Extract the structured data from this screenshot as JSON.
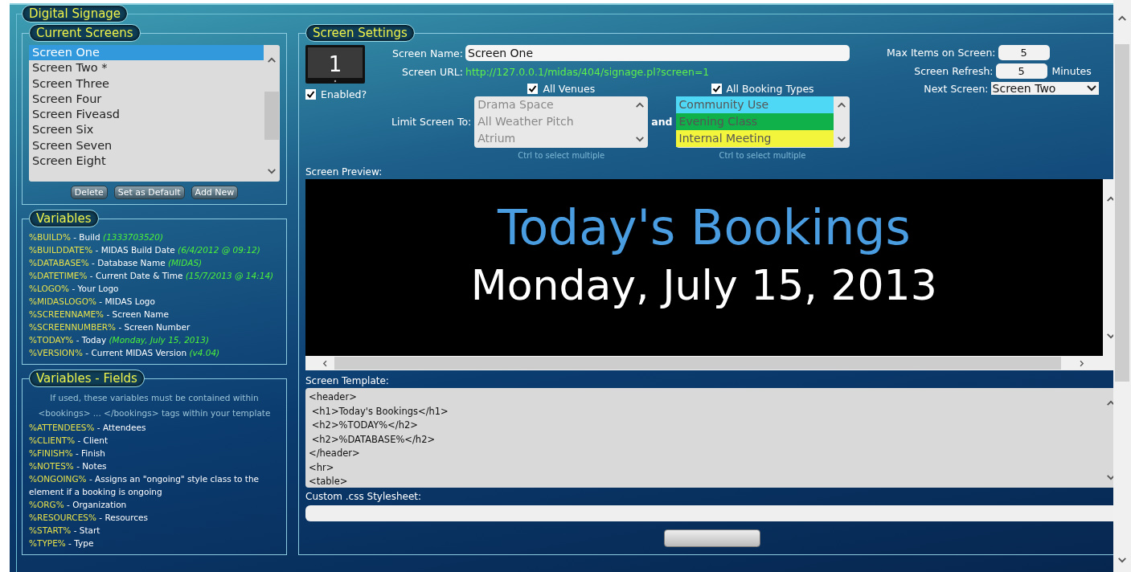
{
  "title": "Digital Signage",
  "current_screens": {
    "legend": "Current Screens",
    "items": [
      {
        "label": "Screen One",
        "selected": true
      },
      {
        "label": "Screen Two *",
        "selected": false
      },
      {
        "label": "Screen Three",
        "selected": false
      },
      {
        "label": "Screen Four",
        "selected": false
      },
      {
        "label": "Screen Fiveasd",
        "selected": false
      },
      {
        "label": "Screen Six",
        "selected": false
      },
      {
        "label": "Screen Seven",
        "selected": false
      },
      {
        "label": "Screen Eight",
        "selected": false
      }
    ],
    "buttons": [
      "Delete",
      "Set as Default",
      "Add New"
    ]
  },
  "variables": {
    "legend": "Variables",
    "items": [
      {
        "code": "%BUILD%",
        "desc": "- Build",
        "example": "(1333703520)"
      },
      {
        "code": "%BUILDDATE%",
        "desc": "- MIDAS Build Date",
        "example": "(6/4/2012 @ 09:12)"
      },
      {
        "code": "%DATABASE%",
        "desc": "- Database Name",
        "example": "(MIDAS)"
      },
      {
        "code": "%DATETIME%",
        "desc": "- Current Date & Time",
        "example": "(15/7/2013 @ 14:14)"
      },
      {
        "code": "%LOGO%",
        "desc": "- Your Logo"
      },
      {
        "code": "%MIDASLOGO%",
        "desc": "- MIDAS Logo"
      },
      {
        "code": "%SCREENNAME%",
        "desc": "- Screen Name"
      },
      {
        "code": "%SCREENNUMBER%",
        "desc": "- Screen Number"
      },
      {
        "code": "%TODAY%",
        "desc": "- Today",
        "example": "(Monday, July 15, 2013)"
      },
      {
        "code": "%VERSION%",
        "desc": "- Current MIDAS Version",
        "example": "(v4.04)"
      }
    ]
  },
  "variable_fields": {
    "legend": "Variables - Fields",
    "note": "If used, these variables must be contained within <bookings> ... </bookings> tags within your template",
    "items": [
      {
        "code": "%ATTENDEES%",
        "desc": "- Attendees"
      },
      {
        "code": "%CLIENT%",
        "desc": "- Client"
      },
      {
        "code": "%FINISH%",
        "desc": "- Finish"
      },
      {
        "code": "%NOTES%",
        "desc": "- Notes"
      },
      {
        "code": "%ONGOING%",
        "desc": "- Assigns an \"ongoing\" style class to the element if a booking is ongoing"
      },
      {
        "code": "%ORG%",
        "desc": "- Organization"
      },
      {
        "code": "%RESOURCES%",
        "desc": "- Resources"
      },
      {
        "code": "%START%",
        "desc": "- Start"
      },
      {
        "code": "%TYPE%",
        "desc": "- Type"
      }
    ]
  },
  "screen_settings": {
    "legend": "Screen Settings",
    "screen_number": "1",
    "enabled": {
      "label": "Enabled?",
      "checked": true
    },
    "screen_name": {
      "label": "Screen Name:",
      "value": "Screen One"
    },
    "screen_url": {
      "label": "Screen URL:",
      "value": "http://127.0.0.1/midas/404/signage.pl?screen=1"
    },
    "limit_label": "Limit Screen To:",
    "and_label": "and",
    "venues": {
      "label": "All Venues",
      "checked": true,
      "hint": "Ctrl to select multiple",
      "items": [
        {
          "label": "Drama Space"
        },
        {
          "label": "All Weather Pitch"
        },
        {
          "label": "Atrium"
        }
      ]
    },
    "booking_types": {
      "label": "All Booking Types",
      "checked": true,
      "hint": "Ctrl to select multiple",
      "items": [
        {
          "label": "Community Use",
          "color": "#4fd8f5"
        },
        {
          "label": "Evening Class",
          "color": "#10b04a"
        },
        {
          "label": "Internal Meeting",
          "color": "#f2f53c"
        }
      ]
    },
    "max_items": {
      "label": "Max Items on Screen:",
      "value": "5"
    },
    "refresh": {
      "label": "Screen Refresh:",
      "value": "5",
      "unit": "Minutes"
    },
    "next_screen": {
      "label": "Next Screen:",
      "value": "Screen Two"
    },
    "preview": {
      "label": "Screen Preview:",
      "heading": "Today's Bookings",
      "date": "Monday, July 15, 2013"
    },
    "template": {
      "label": "Screen Template:",
      "lines": [
        "<header>",
        " <h1>Today's Bookings</h1>",
        " <h2>%TODAY%</h2>",
        " <h2>%DATABASE%</h2>",
        "</header>",
        "<hr>",
        "<table>"
      ]
    },
    "stylesheet": {
      "label": "Custom .css Stylesheet:"
    }
  }
}
